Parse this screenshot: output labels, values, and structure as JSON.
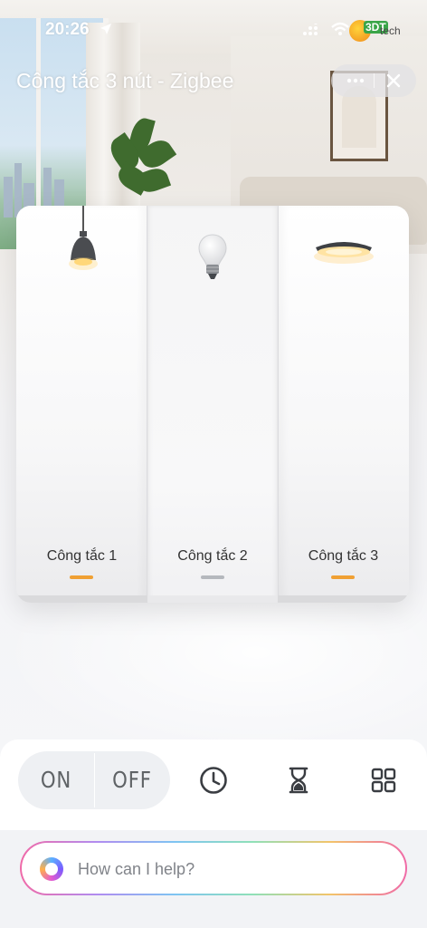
{
  "status_bar": {
    "time": "20:26",
    "brand_badge": "3DT",
    "brand_text": "tech",
    "icons": [
      "location-arrow-icon",
      "signal-icon",
      "wifi-icon"
    ]
  },
  "header": {
    "title": "Công tắc 3 nút - Zigbee",
    "more_icon": "more-dots-icon",
    "close_icon": "close-icon"
  },
  "switch_panel": {
    "keys": [
      {
        "label": "Công tắc 1",
        "state": "on",
        "icon": "pendant-lamp-icon",
        "indicator_color": "#f0a033"
      },
      {
        "label": "Công tắc 2",
        "state": "off",
        "icon": "light-bulb-icon",
        "indicator_color": "#b5b8bd"
      },
      {
        "label": "Công tắc 3",
        "state": "on",
        "icon": "ceiling-lamp-icon",
        "indicator_color": "#f0a033"
      }
    ]
  },
  "actions": {
    "on_label": "ON",
    "off_label": "OFF",
    "icons": [
      "clock-icon",
      "hourglass-icon",
      "grid-icon"
    ]
  },
  "assistant": {
    "placeholder": "How can I help?",
    "icon": "assistant-orb-icon"
  }
}
